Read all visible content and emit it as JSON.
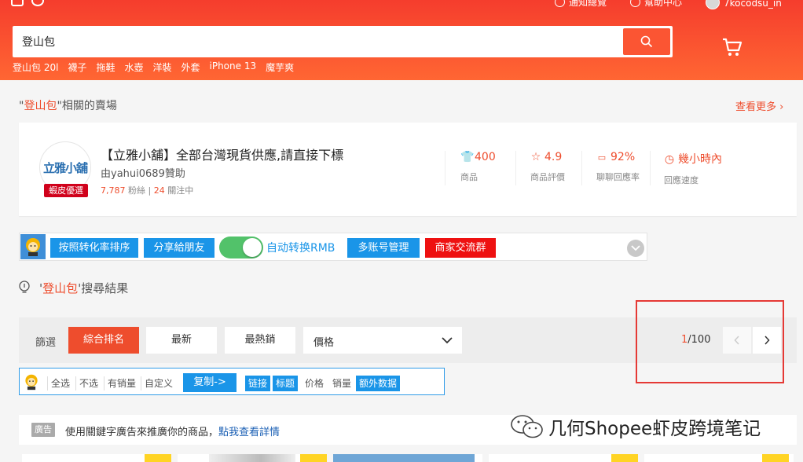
{
  "topbar": {
    "notifications": "通知總覽",
    "help": "幫助中心",
    "username": "7kocodsu_in"
  },
  "search": {
    "value": "登山包",
    "hot_words": [
      "登山包 20l",
      "襪子",
      "拖鞋",
      "水壺",
      "洋裝",
      "外套",
      "iPhone 13",
      "魔芋爽"
    ]
  },
  "related_shop": {
    "title_prefix": "\"",
    "keyword": "登山包",
    "title_suffix": "\"相關的賣場",
    "see_more": "查看更多 ›",
    "logo_text": "立雅小舖",
    "badge": "蝦皮優選",
    "name": "【立雅小舖】全部台灣現貨供應,請直接下標",
    "owner": "由yahui0689贊助",
    "followers": "7,787",
    "followers_label": "粉絲",
    "following": "24",
    "following_label": "關注中",
    "metrics": [
      {
        "icon": "shirt-icon",
        "glyph": "👕",
        "value": "400",
        "label": "商品"
      },
      {
        "icon": "star-icon",
        "glyph": "☆",
        "value": "4.9",
        "label": "商品評價"
      },
      {
        "icon": "chat-icon",
        "glyph": "💬",
        "value": "92%",
        "label": "聊聊回應率"
      },
      {
        "icon": "clock-icon",
        "glyph": "◷",
        "value": "幾小時內",
        "label": "回應速度"
      }
    ]
  },
  "plugin": {
    "sort_by_conversion": "按照转化率排序",
    "share": "分享給朋友",
    "auto_rmb": "自动转换RMB",
    "multi_account": "多账号管理",
    "merchant_group": "商家交流群"
  },
  "result_title": {
    "prefix": "'",
    "keyword": "登山包",
    "suffix": "'搜尋結果"
  },
  "sort": {
    "label": "篩選",
    "options": [
      "綜合排名",
      "最新",
      "最熱銷"
    ],
    "price": "價格",
    "current_page": "1",
    "total_pages": "/100"
  },
  "plugin_filter": {
    "select_all": "全选",
    "select_none": "不选",
    "has_sales": "有销量",
    "custom": "自定义",
    "copy": "复制->",
    "tags_on": [
      "链接",
      "标题"
    ],
    "tags_off": [
      "价格",
      "销量"
    ],
    "extra": "额外数据"
  },
  "ad_notice": {
    "badge": "廣告",
    "text": "使用關鍵字廣告來推廣你的商品，",
    "link": "點我查看詳情"
  },
  "watermark": "几何Shopee虾皮跨境笔记",
  "colors": {
    "brand": "#ee4d2d",
    "header": "#f53d2d",
    "plugin_blue": "#1a95e8",
    "toggle_green": "#52c26a"
  }
}
